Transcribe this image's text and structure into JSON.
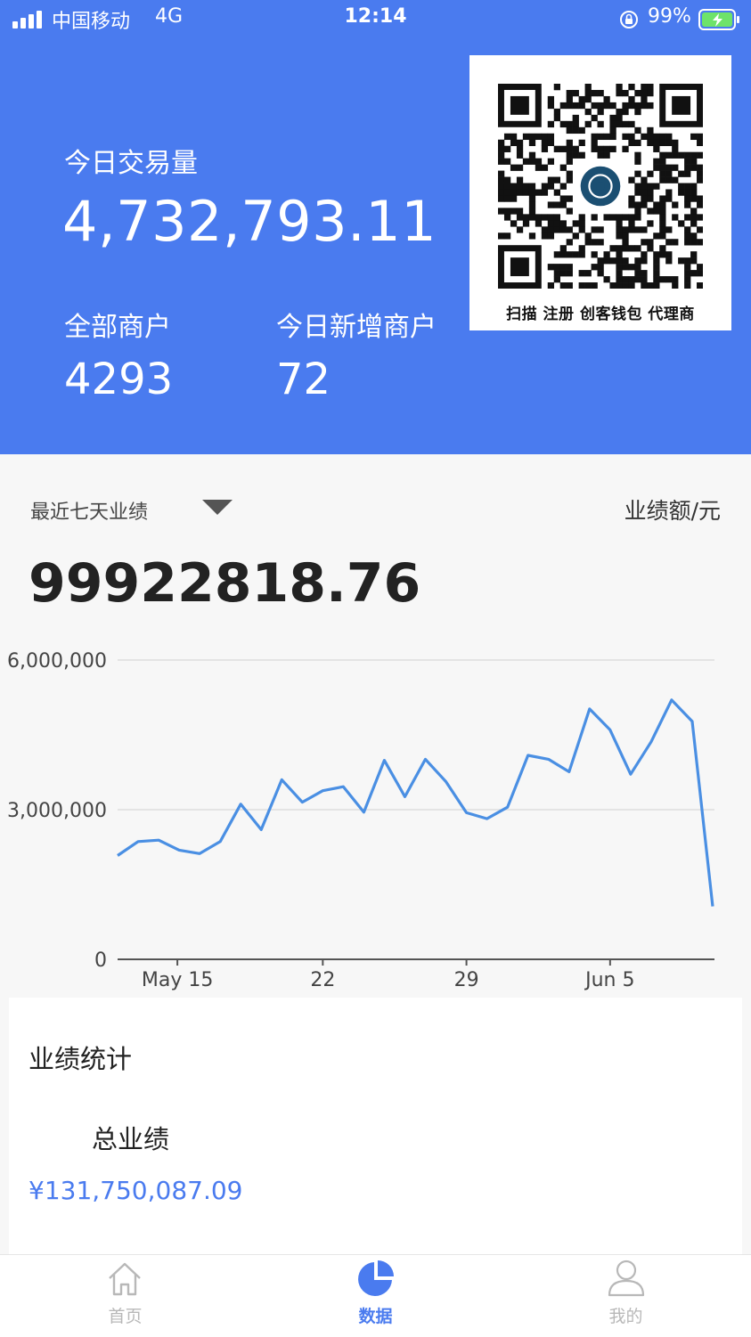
{
  "status_bar": {
    "carrier": "中国移动",
    "network": "4G",
    "time": "12:14",
    "battery": "99%"
  },
  "header": {
    "today_volume_label": "今日交易量",
    "today_volume_value": "4,732,793.11",
    "all_merchants_label": "全部商户",
    "all_merchants_value": "4293",
    "new_merchants_label": "今日新增商户",
    "new_merchants_value": "72",
    "qr_caption": "扫描 注册 创客钱包 代理商"
  },
  "performance": {
    "range_label": "最近七天业绩",
    "unit_label": "业绩额/元",
    "total": "99922818.76"
  },
  "chart_data": {
    "type": "line",
    "x_ticks": [
      "May 15",
      "22",
      "29",
      "Jun 5"
    ],
    "y_ticks": [
      "6,000,000",
      "3,000,000",
      "0"
    ],
    "ylim": [
      0,
      6000000
    ],
    "grid": true,
    "series": [
      {
        "values": [
          2080000,
          2360000,
          2390000,
          2190000,
          2120000,
          2360000,
          3110000,
          2600000,
          3600000,
          3150000,
          3380000,
          3460000,
          2950000,
          3990000,
          3260000,
          4010000,
          3560000,
          2940000,
          2820000,
          3050000,
          4090000,
          4010000,
          3760000,
          5020000,
          4600000,
          3710000,
          4360000,
          5200000,
          4770000,
          1060000
        ]
      }
    ],
    "line_color": "#4a8fe3"
  },
  "stats": {
    "title": "业绩统计",
    "total_label": "总业绩",
    "total_value": "¥131,750,087.09"
  },
  "tabbar": {
    "home": "首页",
    "data": "数据",
    "mine": "我的",
    "active_color": "#4a7bef",
    "inactive_color": "#b8b8b8"
  }
}
